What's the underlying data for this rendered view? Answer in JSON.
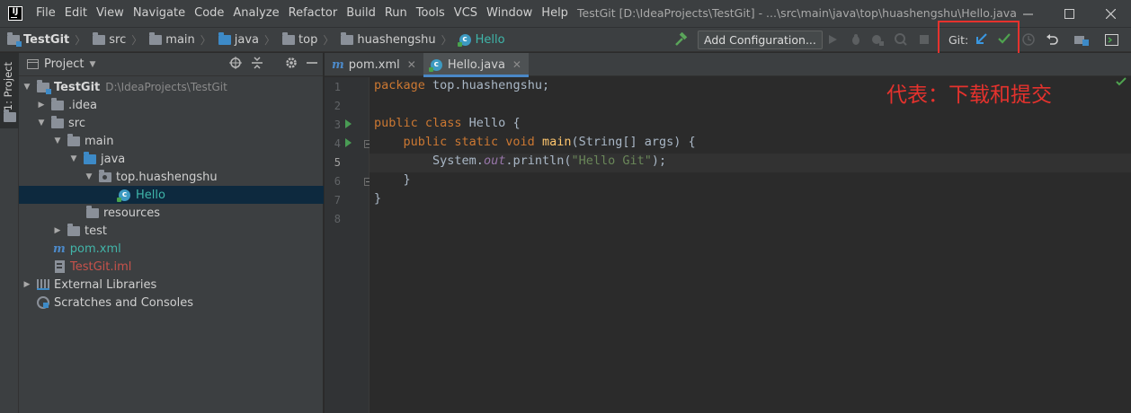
{
  "menu": [
    "File",
    "Edit",
    "View",
    "Navigate",
    "Code",
    "Analyze",
    "Refactor",
    "Build",
    "Run",
    "Tools",
    "VCS",
    "Window",
    "Help"
  ],
  "window_title": "TestGit [D:\\IdeaProjects\\TestGit] - ...\\src\\main\\java\\top\\huashengshu\\Hello.java",
  "breadcrumbs": [
    "TestGit",
    "src",
    "main",
    "java",
    "top",
    "huashengshu",
    "Hello"
  ],
  "toolbar": {
    "add_configuration": "Add Configuration...",
    "git_label": "Git:"
  },
  "left_strip": {
    "project_tab": "1: Project"
  },
  "project_panel": {
    "title": "Project",
    "root_name": "TestGit",
    "root_path": "D:\\IdeaProjects\\TestGit",
    "items": {
      "idea": ".idea",
      "src": "src",
      "main": "main",
      "java": "java",
      "package": "top.huashengshu",
      "hello": "Hello",
      "resources": "resources",
      "test": "test",
      "pom": "pom.xml",
      "iml": "TestGit.iml",
      "ext_libs": "External Libraries",
      "scratches": "Scratches and Consoles"
    }
  },
  "editor": {
    "tabs": [
      {
        "label": "pom.xml",
        "active": false
      },
      {
        "label": "Hello.java",
        "active": true
      }
    ],
    "line_numbers": [
      "1",
      "2",
      "3",
      "4",
      "5",
      "6",
      "7",
      "8"
    ],
    "code": {
      "l1_kw": "package",
      "l1_rest": " top.huashengshu;",
      "l3_kw": "public class",
      "l3_rest": " Hello {",
      "l4_kw": "public static void",
      "l4_fn": "main",
      "l4_rest": "(String[] args) {",
      "l5_pre": "System.",
      "l5_out": "out",
      "l5_mid": ".println(",
      "l5_str": "\"Hello Git\"",
      "l5_end": ");",
      "l6": "}",
      "l7": "}"
    }
  },
  "annotation": "代表：下载和提交",
  "colors": {
    "highlight_red": "#e5322d",
    "keyword": "#cc7832",
    "string": "#6a8759",
    "function": "#ffc66d",
    "selection": "#0d293e"
  }
}
